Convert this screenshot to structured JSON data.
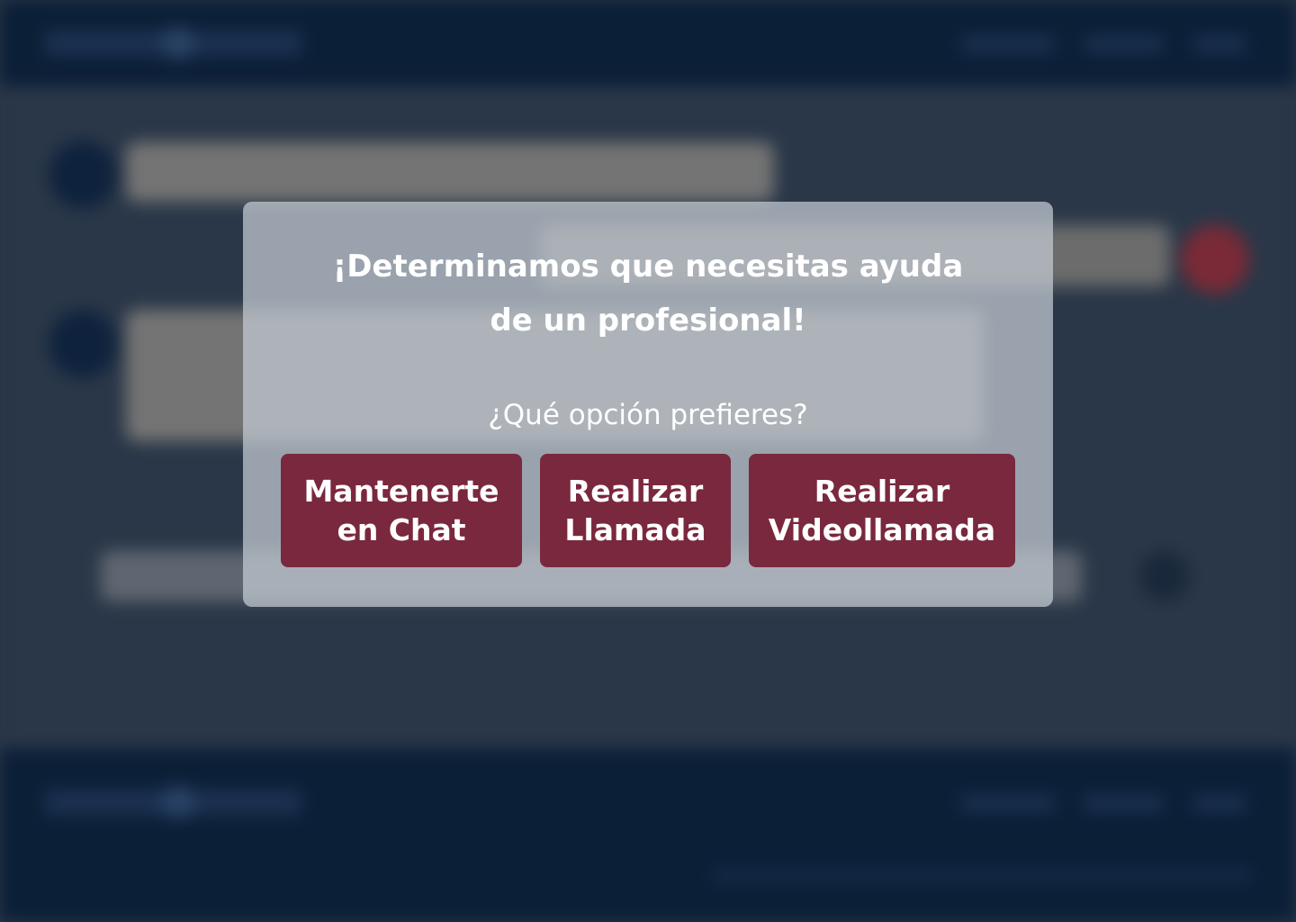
{
  "modal": {
    "title_line1": "¡Determinamos que necesitas ayuda",
    "title_line2": "de un profesional!",
    "question": "¿Qué opción prefieres?",
    "options": [
      {
        "line1": "Mantenerte",
        "line2": "en Chat"
      },
      {
        "line1": "Realizar",
        "line2": "Llamada"
      },
      {
        "line1": "Realizar",
        "line2": "Videollamada"
      }
    ]
  },
  "colors": {
    "button_background": "#7a283d",
    "header_background": "#0b1f37",
    "page_background": "#2a3748",
    "modal_background": "#c5ccd4"
  }
}
